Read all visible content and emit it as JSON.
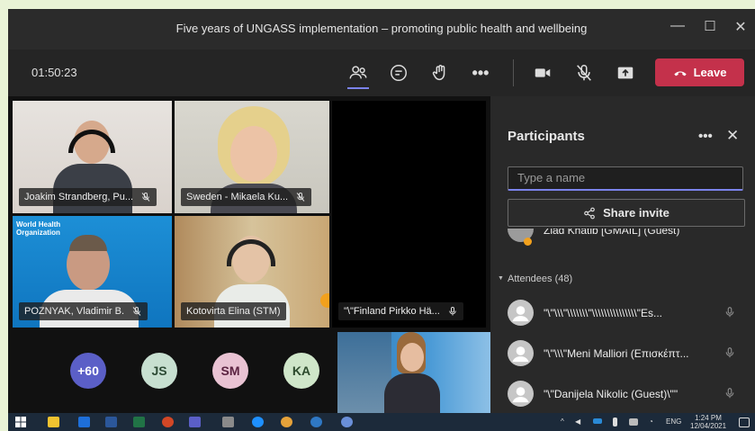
{
  "window": {
    "title": "Five years of UNGASS implementation – promoting public health and wellbeing"
  },
  "toolbar": {
    "timer": "01:50:23",
    "leave_label": "Leave"
  },
  "video_tiles": [
    {
      "name": "Joakim Strandberg, Pu..."
    },
    {
      "name": "Sweden - Mikaela Ku..."
    },
    {
      "name": "POZNYAK, Vladimir B."
    },
    {
      "name": "Kotovirta Elina (STM)"
    },
    {
      "name": "\"\\\"Finland Pirkko Hä..."
    }
  ],
  "who_logo_text": [
    "World Health",
    "Organization"
  ],
  "bubbles": [
    {
      "label": "+60",
      "color": "#5b5fc7",
      "text_color": "#ffffff"
    },
    {
      "label": "JS",
      "color": "#c7dfd0",
      "text_color": "#2c4a35"
    },
    {
      "label": "SM",
      "color": "#e9c3d3",
      "text_color": "#5a2240"
    },
    {
      "label": "KA",
      "color": "#cfe6c9",
      "text_color": "#2c4a2c"
    }
  ],
  "participants_panel": {
    "title": "Participants",
    "search_placeholder": "Type a name",
    "share_invite_label": "Share invite",
    "cut_off_row": "Ziad Khatib [GMAIL] (Guest)",
    "attendees_header": "Attendees (48)",
    "attendees": [
      {
        "name": "\"\\\"\\\\\\\"\\\\\\\\\\\\\\\"\\\\\\\\\\\\\\\\\\\\\\\\\\\\\\\"Es..."
      },
      {
        "name": "\"\\\"\\\\\\\"Meni Malliori (Επισκέπτ..."
      },
      {
        "name": "\"\\\"Danijela Nikolic (Guest)\\\"\""
      }
    ]
  },
  "taskbar": {
    "lang": "ENG",
    "time": "1:24 PM",
    "date": "12/04/2021"
  }
}
